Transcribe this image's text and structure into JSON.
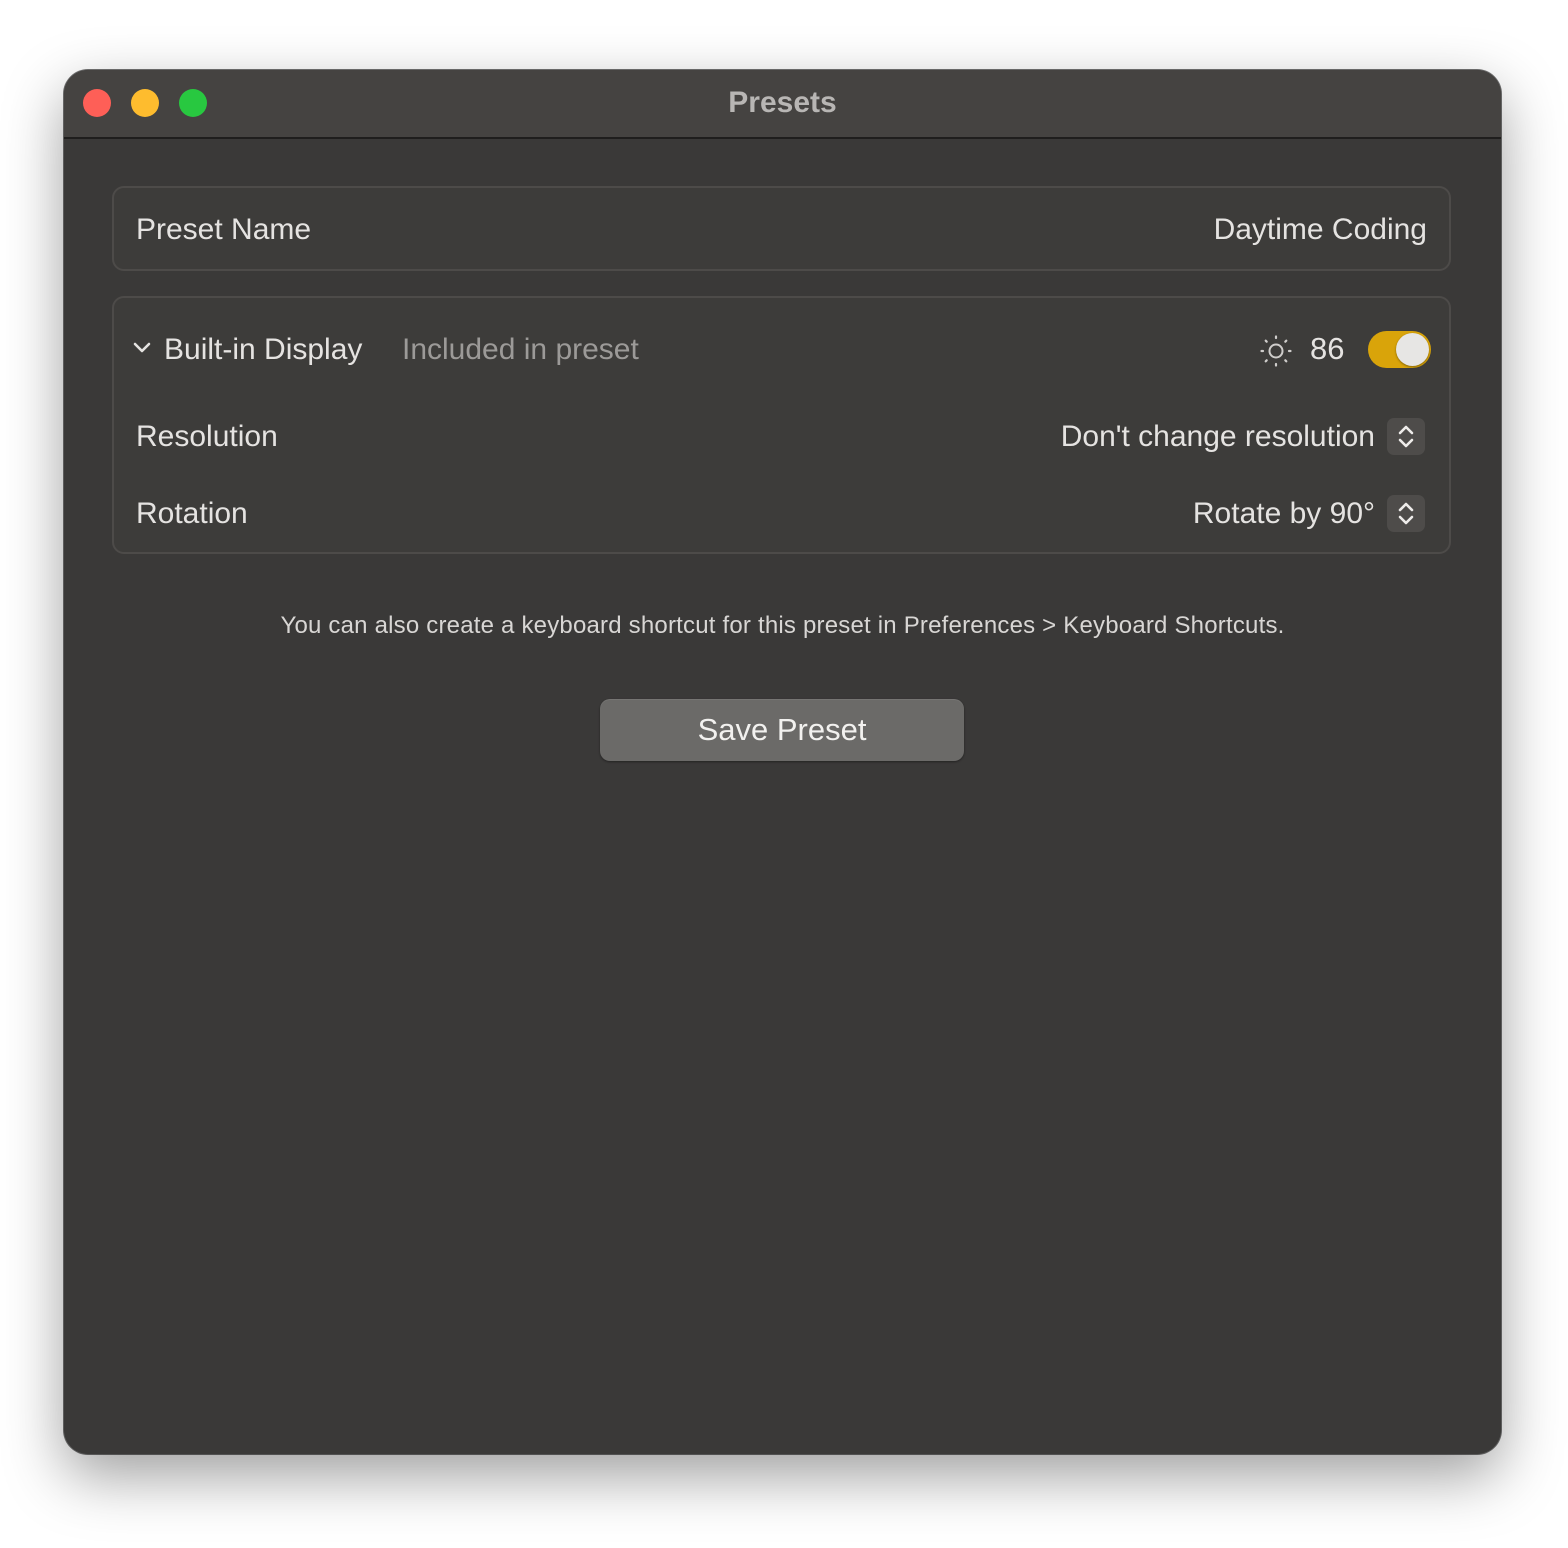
{
  "window": {
    "title": "Presets"
  },
  "preset_name": {
    "label": "Preset Name",
    "value": "Daytime Coding"
  },
  "display": {
    "name": "Built-in Display",
    "status": "Included in preset",
    "brightness": "86",
    "included_toggle_on": true,
    "toggle_color": "#d9a40a",
    "resolution": {
      "label": "Resolution",
      "value": "Don't change resolution"
    },
    "rotation": {
      "label": "Rotation",
      "value": "Rotate by 90°"
    }
  },
  "hint_text": "You can also create a keyboard shortcut for this preset in Preferences > Keyboard Shortcuts.",
  "save_button": {
    "label": "Save Preset"
  },
  "icons": {
    "chevron": "chevron-down-icon",
    "brightness": "sun-icon",
    "stepper": "up-down-chevron-icon"
  },
  "colors": {
    "close": "#fe5f57",
    "minimize": "#febc2e",
    "maximize": "#28c840"
  }
}
